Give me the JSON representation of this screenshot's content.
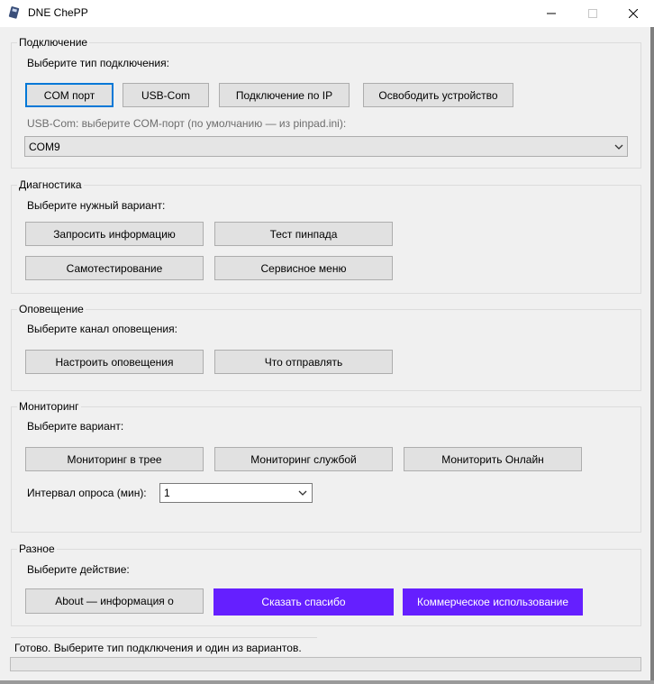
{
  "window": {
    "title": "DNE ChePP",
    "controls": [
      "minimize",
      "maximize",
      "close"
    ]
  },
  "connection": {
    "group_title": "Подключение",
    "prompt": "Выберите тип подключения:",
    "buttons": [
      "COM порт",
      "USB-Com",
      "Подключение по IP",
      "Освободить устройство"
    ],
    "selected_button": "COM порт",
    "port_hint": "USB-Com: выберите COM-порт (по умолчанию — из pinpad.ini):",
    "port_value": "COM9"
  },
  "diagnostics": {
    "group_title": "Диагностика",
    "prompt": "Выберите нужный вариант:",
    "buttons": [
      "Запросить информацию",
      "Тест пинпада",
      "Самотестирование",
      "Сервисное меню"
    ]
  },
  "notification": {
    "group_title": "Оповещение",
    "prompt": "Выберите канал оповещения:",
    "buttons": [
      "Настроить оповещения",
      "Что отправлять"
    ]
  },
  "monitoring": {
    "group_title": "Мониторинг",
    "prompt": "Выберите вариант:",
    "buttons": [
      "Мониторинг в трее",
      "Мониторинг службой",
      "Мониторить Онлайн"
    ],
    "interval_label": "Интервал опроса (мин):",
    "interval_value": "1"
  },
  "misc": {
    "group_title": "Разное",
    "prompt": "Выберите действие:",
    "buttons": [
      "About — информация о",
      "Сказать спасибо",
      "Коммерческое использование"
    ]
  },
  "status": {
    "text": "Готово. Выберите тип подключения и один из вариантов.",
    "progress": 0
  },
  "colors": {
    "accent_purple": "#651fff",
    "focus_blue": "#0078d7"
  },
  "icons": {
    "app": "app-icon",
    "dropdown": "chevron-down-icon"
  }
}
